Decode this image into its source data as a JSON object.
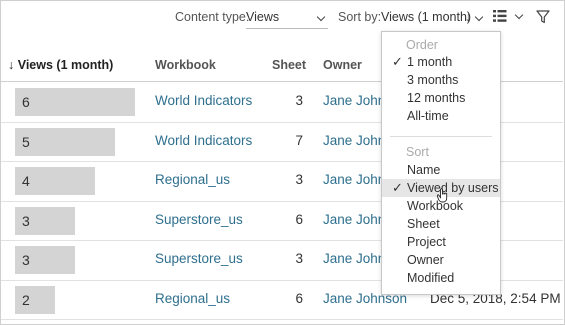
{
  "toolbar": {
    "content_type_label": "Content type:",
    "content_type_value": "Views",
    "sort_by_label": "Sort by:",
    "sort_by_value": "Views (1 month)",
    "sort_direction_icon": "↓"
  },
  "table": {
    "columns": {
      "views": "↓ Views (1 month)",
      "workbook": "Workbook",
      "sheet": "Sheet",
      "owner": "Owner"
    },
    "rows": [
      {
        "views": "6",
        "views_fraction": 0.6,
        "workbook": "World Indicators",
        "sheet": "3",
        "owner": "Jane John",
        "modified": "8, 2:54 PM"
      },
      {
        "views": "5",
        "views_fraction": 0.5,
        "workbook": "World Indicators",
        "sheet": "7",
        "owner": "Jane John",
        "modified": "8, 2:54 PM"
      },
      {
        "views": "4",
        "views_fraction": 0.4,
        "workbook": "Regional_us",
        "sheet": "3",
        "owner": "Jane John",
        "modified": "8, 2:54 PM"
      },
      {
        "views": "3",
        "views_fraction": 0.3,
        "workbook": "Superstore_us",
        "sheet": "6",
        "owner": "Jane John",
        "modified": "8, 2:53 PM"
      },
      {
        "views": "3",
        "views_fraction": 0.3,
        "workbook": "Superstore_us",
        "sheet": "3",
        "owner": "Jane John",
        "modified": "8, 2:53 PM"
      },
      {
        "views": "2",
        "views_fraction": 0.2,
        "workbook": "Regional_us",
        "sheet": "6",
        "owner": "Jane Johnson",
        "modified": "Dec 5, 2018, 2:54 PM"
      }
    ]
  },
  "sort_menu": {
    "order_header": "Order",
    "order_items": [
      {
        "label": "1 month",
        "checked": true
      },
      {
        "label": "3 months",
        "checked": false
      },
      {
        "label": "12 months",
        "checked": false
      },
      {
        "label": "All-time",
        "checked": false
      }
    ],
    "sort_header": "Sort",
    "sort_items": [
      {
        "label": "Name",
        "checked": false
      },
      {
        "label": "Viewed by users",
        "checked": true,
        "hovered": true
      },
      {
        "label": "Workbook",
        "checked": false
      },
      {
        "label": "Sheet",
        "checked": false
      },
      {
        "label": "Project",
        "checked": false
      },
      {
        "label": "Owner",
        "checked": false
      },
      {
        "label": "Modified",
        "checked": false
      }
    ],
    "check_glyph": "✓"
  },
  "colors": {
    "link": "#2e6f8e",
    "bar": "#d4d4d4",
    "hover": "#e6e6e6"
  }
}
